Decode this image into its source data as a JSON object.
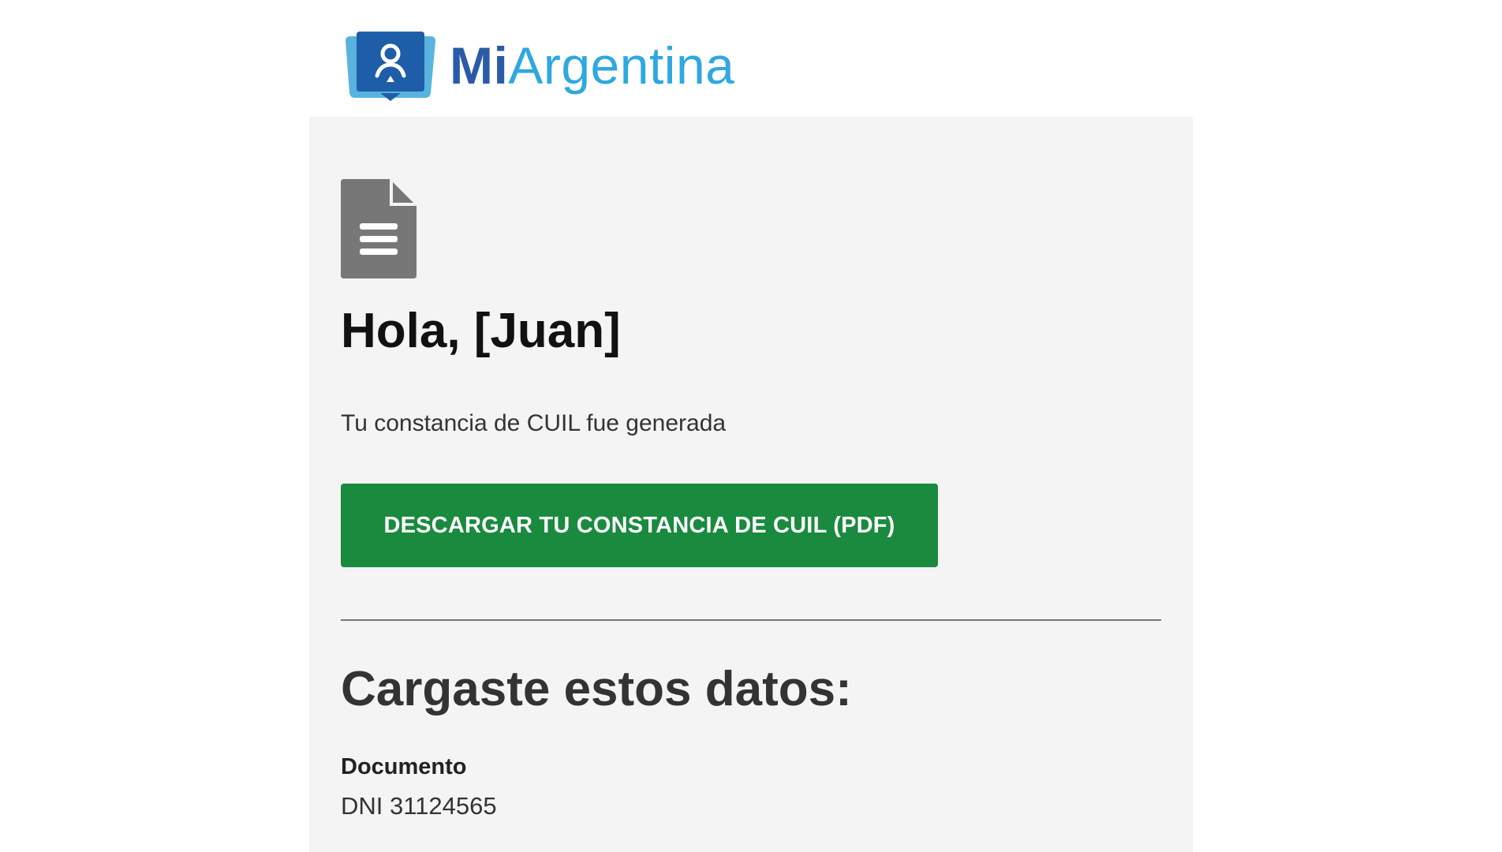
{
  "brand": {
    "name_bold": "Mi",
    "name_light": "Argentina",
    "logo_icon": "person-pin-card-icon",
    "colors": {
      "mi": "#2a5ba6",
      "argentina": "#2fa8df",
      "card_back": "#3ca6d9",
      "card_front": "#1e5ea8"
    }
  },
  "content": {
    "document_icon": "document-icon",
    "greeting": "Hola, [Juan]",
    "message": "Tu constancia de CUIL fue generada",
    "download_button": "DESCARGAR TU CONSTANCIA DE CUIL (PDF)",
    "section_title": "Cargaste estos datos:",
    "fields": [
      {
        "label": "Documento",
        "value": "DNI 31124565"
      }
    ]
  },
  "colors": {
    "button": "#1a8a3f",
    "card_background": "#f4f4f4",
    "icon_gray": "#777777"
  }
}
